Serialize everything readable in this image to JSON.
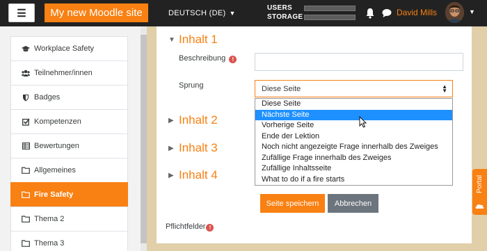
{
  "navbar": {
    "menu_icon": "hamburger-icon",
    "site_name": "My new Moodle site",
    "language": "DEUTSCH (DE)",
    "usage_labels": [
      "USERS",
      "STORAGE"
    ],
    "notifications_icon": "bell-icon",
    "messages_icon": "chat-icon",
    "user_name": "David Mills"
  },
  "drawer": {
    "items": [
      {
        "label": "Workplace Safety",
        "icon": "graduation-cap-icon"
      },
      {
        "label": "Teilnehmer/innen",
        "icon": "users-icon"
      },
      {
        "label": "Badges",
        "icon": "shield-icon"
      },
      {
        "label": "Kompetenzen",
        "icon": "checkbox-icon"
      },
      {
        "label": "Bewertungen",
        "icon": "table-icon"
      },
      {
        "label": "Allgemeines",
        "icon": "folder-icon"
      },
      {
        "label": "Fire Safety",
        "icon": "folder-icon",
        "active": true
      },
      {
        "label": "Thema 2",
        "icon": "folder-icon"
      },
      {
        "label": "Thema 3",
        "icon": "folder-icon"
      }
    ]
  },
  "form": {
    "sections": [
      "Inhalt 1",
      "Inhalt 2",
      "Inhalt 3",
      "Inhalt 4"
    ],
    "beschreibung_label": "Beschreibung",
    "beschreibung_value": "",
    "sprung_label": "Sprung",
    "sprung_value": "Diese Seite",
    "sprung_options": [
      "Diese Seite",
      "Nächste Seite",
      "Vorherige Seite",
      "Ende der Lektion",
      "Noch nicht angezeigte Frage innerhalb des Zweiges",
      "Zufällige Frage innerhalb des Zweiges",
      "Zufällige Inhaltsseite",
      "What to do if a fire starts"
    ],
    "highlighted_option": "Nächste Seite",
    "save_label": "Seite speichern",
    "cancel_label": "Abbrechen",
    "required_note": "Pflichtfelder",
    "required_icon": "!"
  },
  "side_tab": {
    "label": "Portal",
    "icon": "portal-icon"
  },
  "colors": {
    "accent": "#f98012",
    "navbar": "#222222",
    "dropdown_highlight": "#1e90ff",
    "required": "#d9534f",
    "cancel_button": "#6c757d"
  }
}
